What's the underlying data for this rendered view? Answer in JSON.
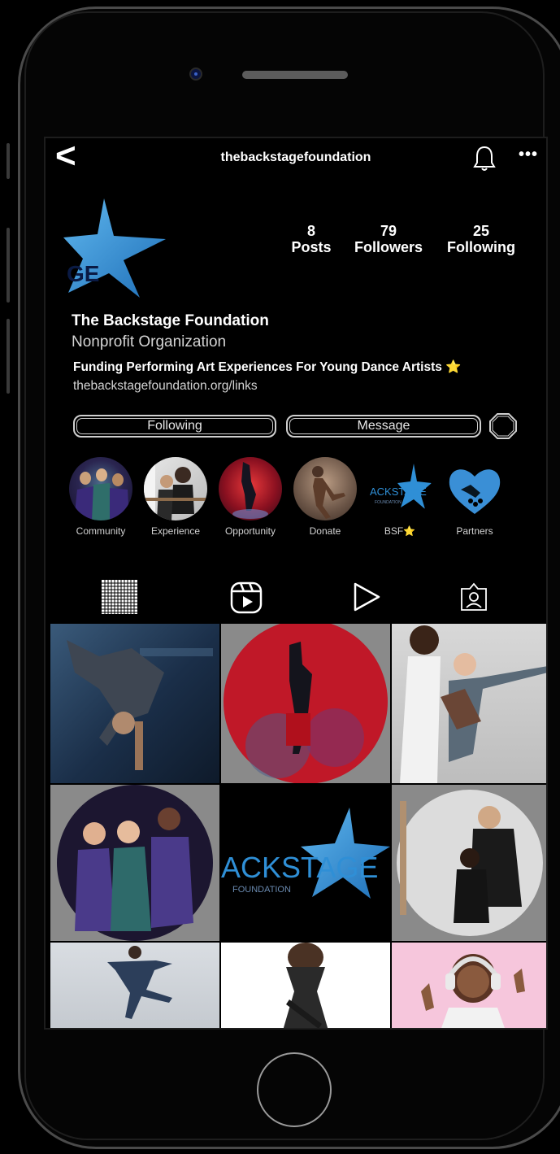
{
  "header": {
    "back_glyph": "<",
    "username": "thebackstagefoundation",
    "more_glyph": "•••"
  },
  "profile": {
    "posts_count": "8",
    "posts_label": "Posts",
    "followers_count": "79",
    "followers_label": "Followers",
    "following_count": "25",
    "following_label": "Following",
    "name": "The Backstage Foundation",
    "category": "Nonprofit Organization",
    "bio": "Funding Performing Art Experiences For Young Dance Artists ⭐",
    "link": "thebackstagefoundation.org/links",
    "avatar_text": "GE"
  },
  "actions": {
    "following_label": "Following",
    "message_label": "Message"
  },
  "highlights": [
    {
      "label": "Community"
    },
    {
      "label": "Experience"
    },
    {
      "label": "Opportunity"
    },
    {
      "label": "Donate"
    },
    {
      "label": "BSF⭐",
      "logo_text": "ACKSTAGE",
      "logo_sub": "FOUNDATION"
    },
    {
      "label": "Partners"
    }
  ],
  "tabs": [
    "grid-icon",
    "reels-icon",
    "play-icon",
    "tagged-icon"
  ],
  "posts": [
    {
      "icon": "breakdancer-photo"
    },
    {
      "icon": "handstand-dancer-photo"
    },
    {
      "icon": "ballet-partners-photo"
    },
    {
      "icon": "young-dancers-photo"
    },
    {
      "icon": "backstage-logo-post",
      "logo_text": "ACKSTAGE",
      "logo_sub": "FOUNDATION"
    },
    {
      "icon": "ballet-barre-photo"
    },
    {
      "icon": "leaping-dancer-photo"
    },
    {
      "icon": "contemporary-dancer-photo"
    },
    {
      "icon": "headphones-dancer-photo"
    }
  ],
  "colors": {
    "brand_blue": "#2f8fd6",
    "background": "#000000",
    "text": "#ffffff"
  }
}
